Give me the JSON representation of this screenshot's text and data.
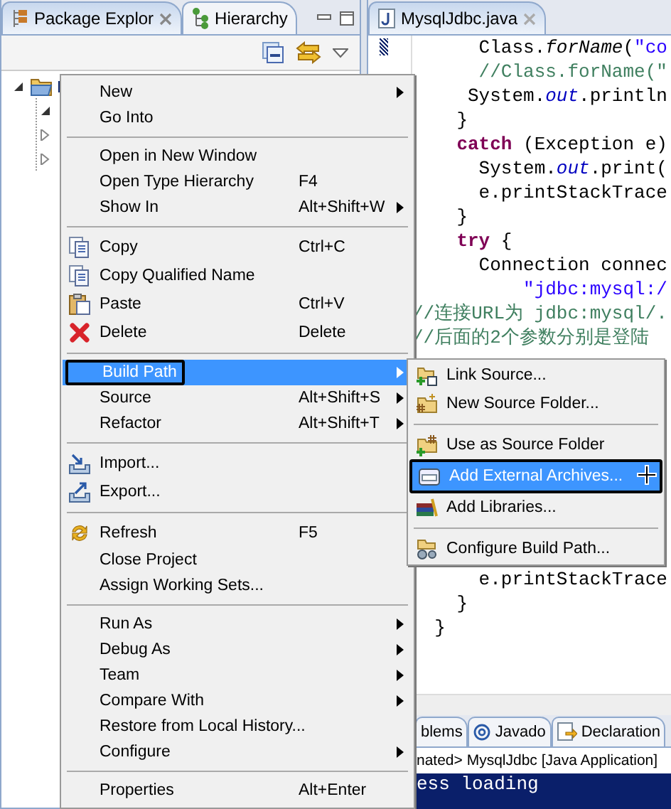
{
  "left_panel": {
    "tabs": [
      {
        "label": "Package Explor",
        "selected": true,
        "closable": true
      },
      {
        "label": "Hierarchy",
        "selected": false,
        "closable": false
      }
    ],
    "tree": [
      {
        "expanded": true,
        "selected": true,
        "children": [
          {
            "expanded": true
          },
          {
            "expanded": false
          },
          {
            "expanded": false
          }
        ]
      }
    ]
  },
  "editor": {
    "tab": {
      "label": "MysqlJdbc.java"
    },
    "lines": [
      {
        "kind": "code",
        "segments": [
          {
            "t": "      Class.",
            "kind": "plain"
          },
          {
            "t": "forName",
            "kind": "static"
          },
          {
            "t": "(",
            "kind": "plain"
          },
          {
            "t": "\"co",
            "kind": "string"
          }
        ]
      },
      {
        "kind": "code",
        "segments": [
          {
            "t": "      //Class.forName(\"",
            "kind": "comment"
          }
        ]
      },
      {
        "kind": "code",
        "segments": [
          {
            "t": "     System.",
            "kind": "plain"
          },
          {
            "t": "out",
            "kind": "field"
          },
          {
            "t": ".println",
            "kind": "plain"
          }
        ]
      },
      {
        "kind": "code",
        "segments": [
          {
            "t": "    }",
            "kind": "plain"
          }
        ]
      },
      {
        "kind": "code",
        "segments": [
          {
            "t": "    catch",
            "kind": "keyword"
          },
          {
            "t": " (Exception e)",
            "kind": "plain"
          }
        ]
      },
      {
        "kind": "code",
        "segments": [
          {
            "t": "      System.",
            "kind": "plain"
          },
          {
            "t": "out",
            "kind": "field"
          },
          {
            "t": ".print(",
            "kind": "plain"
          }
        ]
      },
      {
        "kind": "code",
        "segments": [
          {
            "t": "      e.printStackTrace",
            "kind": "plain"
          }
        ]
      },
      {
        "kind": "code",
        "segments": [
          {
            "t": "    }",
            "kind": "plain"
          }
        ]
      },
      {
        "kind": "code",
        "segments": [
          {
            "t": "    try",
            "kind": "keyword"
          },
          {
            "t": " {",
            "kind": "plain"
          }
        ]
      },
      {
        "kind": "code",
        "segments": [
          {
            "t": "      Connection connec",
            "kind": "plain"
          }
        ]
      },
      {
        "kind": "code",
        "segments": [
          {
            "t": "          \"jdbc:mysql:/",
            "kind": "string"
          }
        ]
      },
      {
        "kind": "code",
        "segments": [
          {
            "t": "//连接URL为 jdbc:mysql/.",
            "kind": "comment"
          }
        ]
      },
      {
        "kind": "code",
        "segments": [
          {
            "t": "//后面的2个参数分别是登陆",
            "kind": "comment"
          }
        ]
      },
      {
        "kind": "blank"
      },
      {
        "kind": "blank"
      },
      {
        "kind": "blank"
      },
      {
        "kind": "blank"
      },
      {
        "kind": "blank"
      },
      {
        "kind": "blank"
      },
      {
        "kind": "blank"
      },
      {
        "kind": "blank"
      },
      {
        "kind": "blank"
      },
      {
        "kind": "code",
        "segments": [
          {
            "t": "      e.printStackTrace",
            "kind": "plain"
          }
        ]
      },
      {
        "kind": "code",
        "segments": [
          {
            "t": "    }",
            "kind": "plain"
          }
        ]
      },
      {
        "kind": "code",
        "segments": [
          {
            "t": "  }",
            "kind": "plain"
          }
        ]
      }
    ]
  },
  "bottom_panel": {
    "tabs": [
      {
        "label": "blems",
        "selected": false
      },
      {
        "label": "Javado",
        "selected": false
      },
      {
        "label": "Declaration",
        "selected": false
      }
    ],
    "console_header": "nated> MysqlJdbc [Java Application]",
    "console_line": "ess loading"
  },
  "context_menu": [
    {
      "kind": "plain",
      "label": "New",
      "submenu": true,
      "selected": false
    },
    {
      "kind": "plain",
      "label": "Go Into",
      "submenu": false,
      "selected": false
    },
    {
      "kind": "separator"
    },
    {
      "kind": "plain",
      "label": "Open in New Window",
      "submenu": false,
      "selected": false
    },
    {
      "kind": "plain",
      "label": "Open Type Hierarchy",
      "shortcut": "F4",
      "submenu": false,
      "selected": false
    },
    {
      "kind": "plain",
      "label": "Show In",
      "shortcut": "Alt+Shift+W",
      "submenu": true,
      "selected": false
    },
    {
      "kind": "separator"
    },
    {
      "kind": "copy",
      "label": "Copy",
      "shortcut": "Ctrl+C",
      "submenu": false,
      "selected": false
    },
    {
      "kind": "copy",
      "label": "Copy Qualified Name",
      "submenu": false,
      "selected": false
    },
    {
      "kind": "paste",
      "label": "Paste",
      "shortcut": "Ctrl+V",
      "submenu": false,
      "selected": false
    },
    {
      "kind": "delete",
      "label": "Delete",
      "shortcut": "Delete",
      "submenu": false,
      "selected": false
    },
    {
      "kind": "separator"
    },
    {
      "kind": "plain",
      "label": "Build Path",
      "submenu": true,
      "selected": true
    },
    {
      "kind": "plain",
      "label": "Source",
      "shortcut": "Alt+Shift+S",
      "submenu": true,
      "selected": false
    },
    {
      "kind": "plain",
      "label": "Refactor",
      "shortcut": "Alt+Shift+T",
      "submenu": true,
      "selected": false
    },
    {
      "kind": "separator"
    },
    {
      "kind": "import",
      "label": "Import...",
      "submenu": false,
      "selected": false
    },
    {
      "kind": "export",
      "label": "Export...",
      "submenu": false,
      "selected": false
    },
    {
      "kind": "separator"
    },
    {
      "kind": "refresh",
      "label": "Refresh",
      "shortcut": "F5",
      "submenu": false,
      "selected": false
    },
    {
      "kind": "plain",
      "label": "Close Project",
      "submenu": false,
      "selected": false
    },
    {
      "kind": "plain",
      "label": "Assign Working Sets...",
      "submenu": false,
      "selected": false
    },
    {
      "kind": "separator"
    },
    {
      "kind": "plain",
      "label": "Run As",
      "submenu": true,
      "selected": false
    },
    {
      "kind": "plain",
      "label": "Debug As",
      "submenu": true,
      "selected": false
    },
    {
      "kind": "plain",
      "label": "Team",
      "submenu": true,
      "selected": false
    },
    {
      "kind": "plain",
      "label": "Compare With",
      "submenu": true,
      "selected": false
    },
    {
      "kind": "plain",
      "label": "Restore from Local History...",
      "submenu": false,
      "selected": false
    },
    {
      "kind": "plain",
      "label": "Configure",
      "submenu": true,
      "selected": false
    },
    {
      "kind": "separator"
    },
    {
      "kind": "plain",
      "label": "Properties",
      "shortcut": "Alt+Enter",
      "submenu": false,
      "selected": false
    }
  ],
  "submenu": [
    {
      "kind": "link",
      "label": "Link Source...",
      "selected": false
    },
    {
      "kind": "folder",
      "label": "New Source Folder...",
      "selected": false
    },
    {
      "kind": "separator"
    },
    {
      "kind": "folder-add",
      "label": "Use as Source Folder",
      "selected": false
    },
    {
      "kind": "archive",
      "label": "Add External Archives...",
      "selected": true
    },
    {
      "kind": "books",
      "label": "Add Libraries...",
      "selected": false
    },
    {
      "kind": "separator"
    },
    {
      "kind": "gears",
      "label": "Configure Build Path...",
      "selected": false
    }
  ]
}
